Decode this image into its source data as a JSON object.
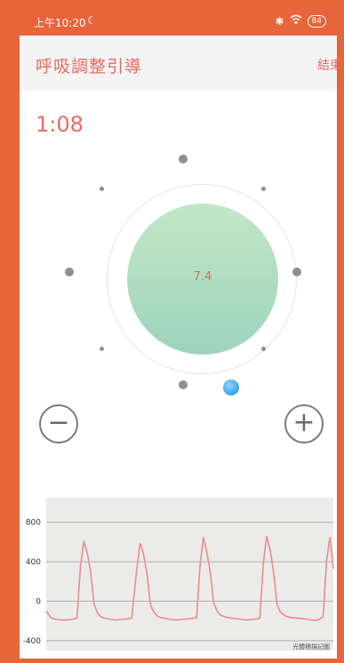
{
  "status_bar": {
    "time": "上午10:20",
    "moon_icon": "☾",
    "bluetooth_icon": "✱",
    "wifi_icon": "wifi",
    "battery": "84"
  },
  "header": {
    "title": "呼吸調整引導",
    "end_label": "結束"
  },
  "timer": "1:08",
  "breath_circle": {
    "value": "7.4"
  },
  "controls": {
    "minus_symbol": "−",
    "plus_symbol": "+"
  },
  "chart_data": {
    "type": "line",
    "yticks": [
      "800",
      "400",
      "0",
      "-400"
    ],
    "ylim": [
      -500,
      1050
    ],
    "watermark": "光體積描記圖",
    "color": "#f08a8a",
    "grid": true,
    "x": [
      0,
      3,
      6,
      9,
      12,
      15,
      18,
      20,
      22,
      24,
      26,
      28,
      30,
      32,
      35,
      38,
      41,
      44,
      47,
      50,
      53,
      55,
      57,
      59,
      61,
      63,
      65,
      67,
      70,
      73,
      76,
      79,
      82,
      85,
      88,
      90,
      92,
      94,
      96,
      98,
      100,
      102,
      105,
      108,
      111,
      114,
      117,
      120,
      123,
      125,
      127,
      129,
      131,
      133,
      135,
      137,
      140,
      143,
      146,
      149,
      152,
      155,
      158,
      160,
      162,
      164,
      166,
      168
    ],
    "y": [
      -100,
      -170,
      -185,
      -190,
      -190,
      -185,
      -170,
      350,
      610,
      490,
      300,
      -30,
      -120,
      -160,
      -175,
      -185,
      -190,
      -185,
      -180,
      -170,
      330,
      590,
      470,
      280,
      -40,
      -110,
      -150,
      -165,
      -175,
      -185,
      -190,
      -185,
      -180,
      -175,
      -165,
      360,
      650,
      500,
      290,
      -20,
      -100,
      -140,
      -160,
      -170,
      -175,
      -185,
      -190,
      -185,
      -180,
      -170,
      380,
      660,
      520,
      300,
      -30,
      -110,
      -150,
      -165,
      -170,
      -175,
      -180,
      -190,
      -195,
      -180,
      -160,
      400,
      650,
      330
    ]
  }
}
